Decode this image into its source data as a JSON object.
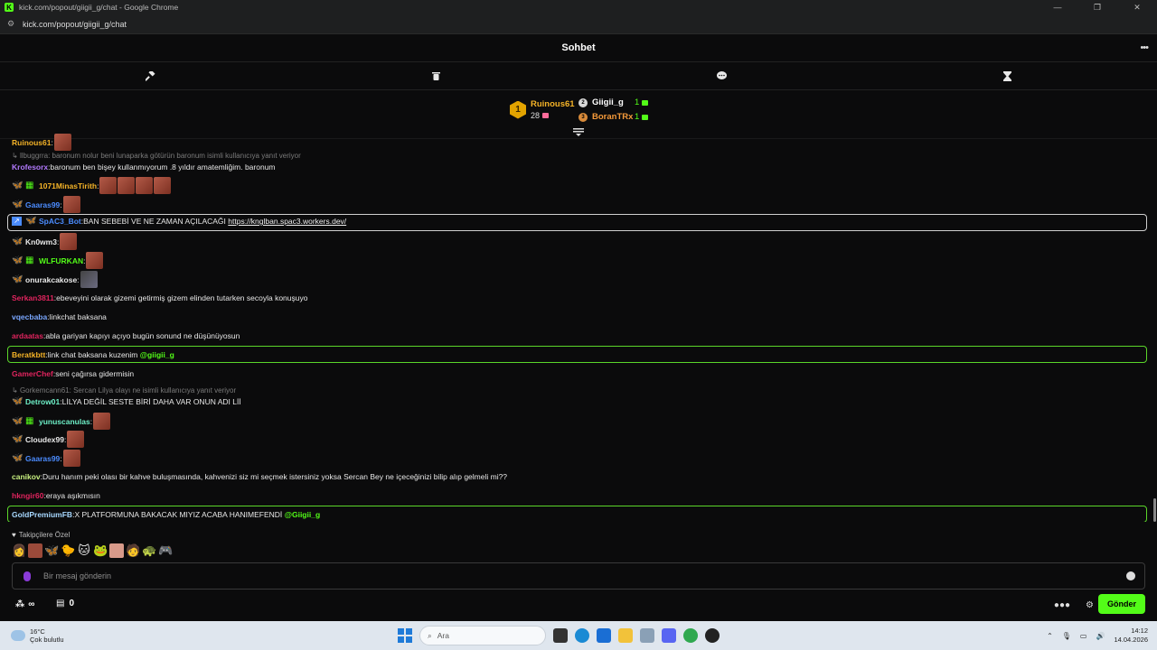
{
  "browser": {
    "window_title": "kick.com/popout/giigii_g/chat - Google Chrome",
    "url": "kick.com/popout/giigii_g/chat"
  },
  "chat": {
    "title": "Sohbet",
    "message_placeholder": "Bir mesaj gönderin",
    "send_label": "Gönder",
    "followers_only_label": "Takipçilere Özel",
    "points_count": "0"
  },
  "leaderboard": {
    "first": {
      "rank": "1",
      "name": "Ruinous61",
      "count": "28"
    },
    "second": {
      "name": "Giigii_g",
      "count": "1"
    },
    "third": {
      "name": "BoranTRx",
      "count": "1"
    }
  },
  "messages": [
    {
      "user": "Ruinous61",
      "user_color": "#f5b327",
      "text": ""
    },
    {
      "reply_to": "llbuggrra: baronum nolur beni lunaparka götürün baronum isimli kullanıcıya yanıt veriyor"
    },
    {
      "user": "Krofesorx",
      "user_color": "#b37aff",
      "text": "baronum ben bişey kullanmıyorum .8 yıldır amatemliğim. baronum"
    },
    {
      "user": "1071MinasTirith",
      "user_color": "#f5b327",
      "text": ""
    },
    {
      "user": "Gaaras99",
      "user_color": "#4b8cff",
      "text": ""
    },
    {
      "user": "SpAC3_Bot",
      "user_color": "#4b8cff",
      "text": "BAN SEBEBİ VE NE ZAMAN AÇILACAĞI",
      "link": "https://knglban.spac3.workers.dev/"
    },
    {
      "user": "Kn0wm3",
      "user_color": "#e8e8e8",
      "text": ""
    },
    {
      "user": "WLFURKAN",
      "user_color": "#53fc18",
      "text": ""
    },
    {
      "user": "onurakcakose",
      "user_color": "#e8e8e8",
      "text": ""
    },
    {
      "user": "Serkan3811",
      "user_color": "#e0245e",
      "text": "ebeveyini olarak gizemi getirmiş gizem elinden tutarken secoyla konuşuyo"
    },
    {
      "user": "vqecbaba",
      "user_color": "#7aa7ff",
      "text": "linkchat baksana"
    },
    {
      "user": "ardaatas",
      "user_color": "#e0245e",
      "text": "abla gariyan kapıyı açıyo bugün sonund ne düşünüyosun"
    },
    {
      "user": "Beratkbtt",
      "user_color": "#f5b327",
      "text": "link chat baksana kuzenim",
      "mention": "@giigii_g"
    },
    {
      "user": "GamerChef",
      "user_color": "#e0245e",
      "text": "seni çağırsa gidermisin"
    },
    {
      "reply_to": "Gorkemcann61: Sercan Lilya olayı ne isimli kullanıcıya yanıt veriyor"
    },
    {
      "user": "Detrow01",
      "user_color": "#6ef0c8",
      "text": "LİLYA DEĞİL SESTE BİRİ DAHA VAR ONUN ADI Lİİ"
    },
    {
      "user": "yunuscanulas",
      "user_color": "#6ef0c8",
      "text": ""
    },
    {
      "user": "Cloudex99",
      "user_color": "#e8e8e8",
      "text": ""
    },
    {
      "user": "Gaaras99",
      "user_color": "#4b8cff",
      "text": ""
    },
    {
      "user": "canikov",
      "user_color": "#c8f080",
      "text": "Duru hanım peki olası bir kahve buluşmasında, kahvenizi siz mi seçmek istersiniz yoksa Sercan Bey ne içeceğinizi bilip alıp gelmeli mi??"
    },
    {
      "user": "hkngir60",
      "user_color": "#e0245e",
      "text": "eraya aşıkmısın"
    },
    {
      "user": "GoldPremiumFB",
      "user_color": "#a8d8ff",
      "text": "X PLATFORMUNA BAKACAK MIYIZ ACABA HANIMEFENDİ",
      "mention": "@Giigii_g"
    }
  ],
  "taskbar": {
    "temperature": "16°C",
    "weather": "Çok bulutlu",
    "search_placeholder": "Ara",
    "time": "14:12",
    "date": "14.04.2026"
  }
}
